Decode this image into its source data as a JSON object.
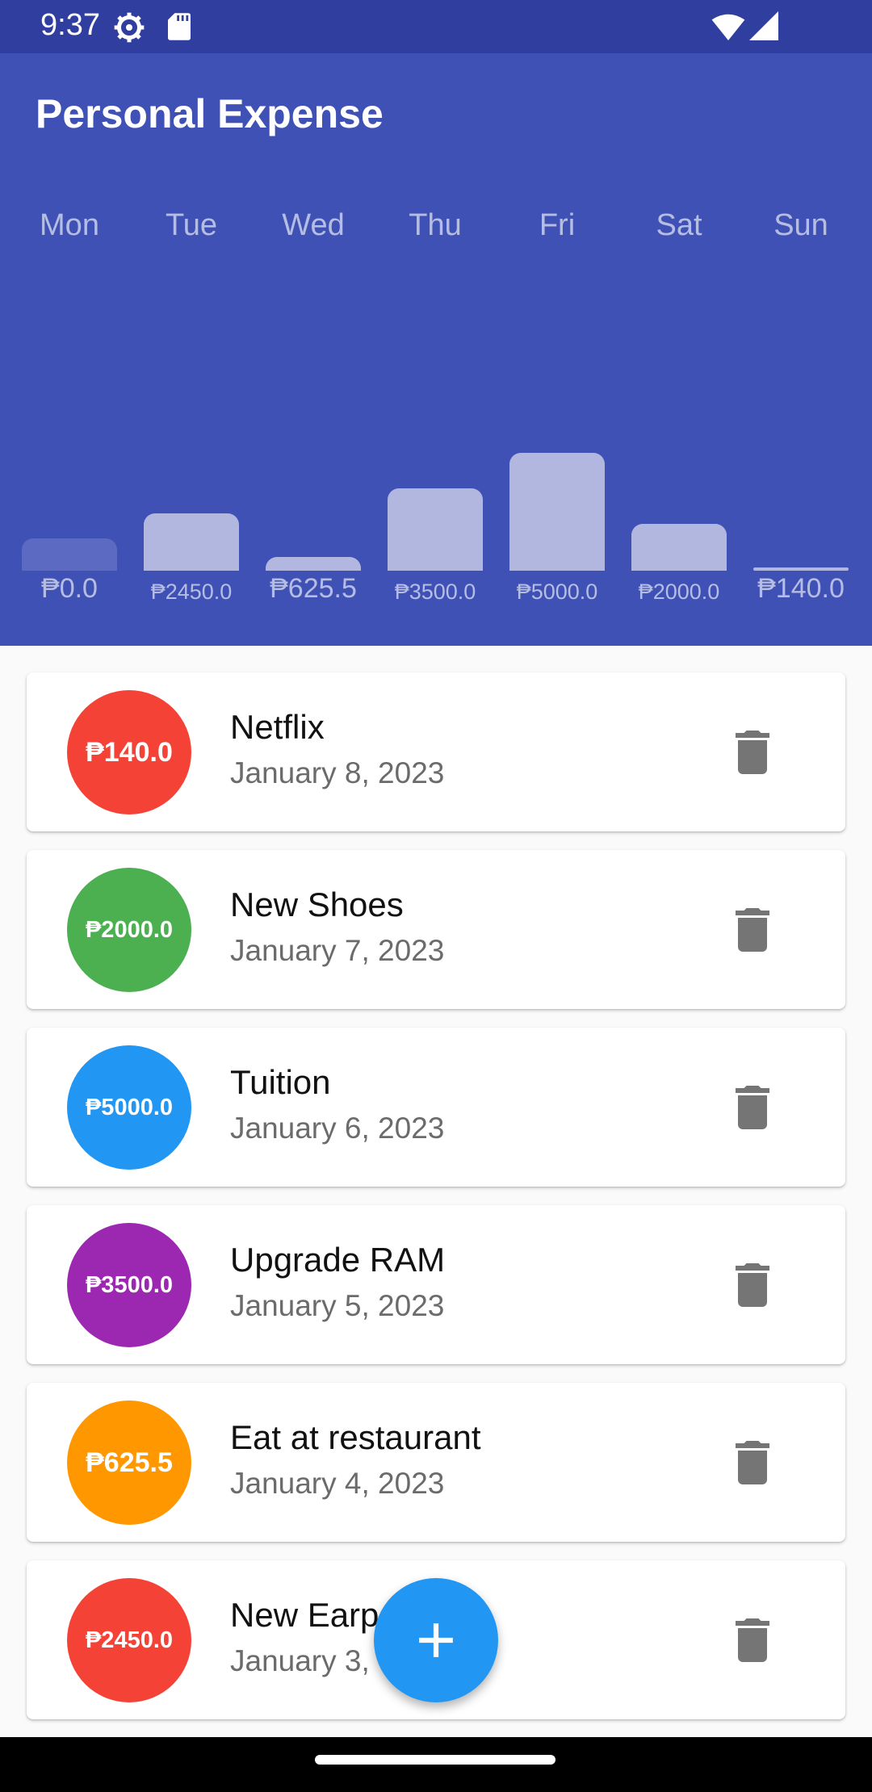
{
  "status_bar": {
    "time": "9:37",
    "icons": [
      "settings-icon",
      "sd-card-icon",
      "wifi-icon",
      "signal-icon"
    ]
  },
  "app": {
    "title": "Personal Expense",
    "primary_color": "#3f51b5"
  },
  "weekly_chart": {
    "days": [
      "Mon",
      "Tue",
      "Wed",
      "Thu",
      "Fri",
      "Sat",
      "Sun"
    ],
    "amounts": [
      "₱0.0",
      "₱2450.0",
      "₱625.5",
      "₱3500.0",
      "₱5000.0",
      "₱2000.0",
      "₱140.0"
    ]
  },
  "transactions": [
    {
      "amount": "₱140.0",
      "title": "Netflix",
      "date": "January 8, 2023",
      "color": "#f44336"
    },
    {
      "amount": "₱2000.0",
      "title": "New Shoes",
      "date": "January 7, 2023",
      "color": "#4caf50"
    },
    {
      "amount": "₱5000.0",
      "title": "Tuition",
      "date": "January 6, 2023",
      "color": "#2196f3"
    },
    {
      "amount": "₱3500.0",
      "title": "Upgrade RAM",
      "date": "January 5, 2023",
      "color": "#9c27b0"
    },
    {
      "amount": "₱625.5",
      "title": "Eat at restaurant",
      "date": "January 4, 2023",
      "color": "#ff9800"
    },
    {
      "amount": "₱2450.0",
      "title": "New Earp",
      "date": "January 3,",
      "color": "#f44336"
    }
  ],
  "fab": {
    "icon": "plus-icon",
    "color": "#2196f3"
  }
}
